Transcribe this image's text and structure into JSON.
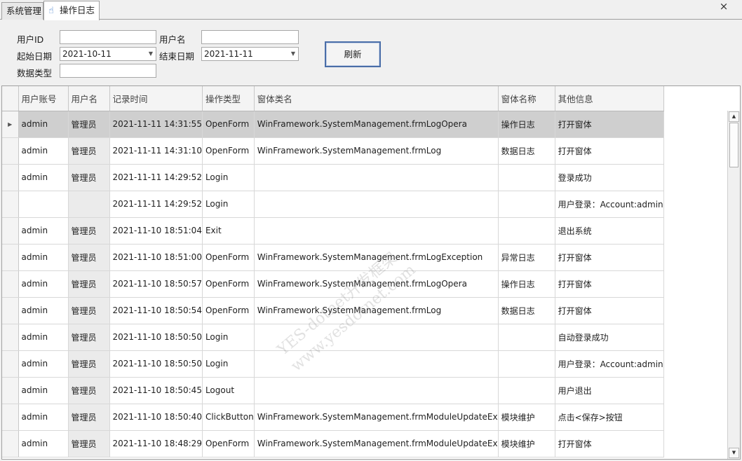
{
  "tabs": [
    {
      "label": "系统管理",
      "active": false
    },
    {
      "label": "操作日志",
      "active": true,
      "icon": "hand-pointer-icon"
    }
  ],
  "close_glyph": "×",
  "filters": {
    "user_id_label": "用户ID",
    "user_id_value": "",
    "user_name_label": "用户名",
    "user_name_value": "",
    "start_date_label": "起始日期",
    "start_date_value": "2021-10-11",
    "end_date_label": "结束日期",
    "end_date_value": "2021-11-11",
    "data_type_label": "数据类型",
    "data_type_value": "",
    "refresh_label": "刷新"
  },
  "grid": {
    "columns": [
      "用户账号",
      "用户名",
      "记录时间",
      "操作类型",
      "窗体类名",
      "窗体名称",
      "其他信息"
    ],
    "rows": [
      [
        "admin",
        "管理员",
        "2021-11-11 14:31:55",
        "OpenForm",
        "WinFramework.SystemManagement.frmLogOpera",
        "操作日志",
        "打开窗体"
      ],
      [
        "admin",
        "管理员",
        "2021-11-11 14:31:10",
        "OpenForm",
        "WinFramework.SystemManagement.frmLog",
        "数据日志",
        "打开窗体"
      ],
      [
        "admin",
        "管理员",
        "2021-11-11 14:29:52",
        "Login",
        "",
        "",
        "登录成功"
      ],
      [
        "",
        "",
        "2021-11-11 14:29:52",
        "Login",
        "",
        "",
        "用户登录：Account:admin"
      ],
      [
        "admin",
        "管理员",
        "2021-11-10 18:51:04",
        "Exit",
        "",
        "",
        "退出系统"
      ],
      [
        "admin",
        "管理员",
        "2021-11-10 18:51:00",
        "OpenForm",
        "WinFramework.SystemManagement.frmLogException",
        "异常日志",
        "打开窗体"
      ],
      [
        "admin",
        "管理员",
        "2021-11-10 18:50:57",
        "OpenForm",
        "WinFramework.SystemManagement.frmLogOpera",
        "操作日志",
        "打开窗体"
      ],
      [
        "admin",
        "管理员",
        "2021-11-10 18:50:54",
        "OpenForm",
        "WinFramework.SystemManagement.frmLog",
        "数据日志",
        "打开窗体"
      ],
      [
        "admin",
        "管理员",
        "2021-11-10 18:50:50",
        "Login",
        "",
        "",
        "自动登录成功"
      ],
      [
        "admin",
        "管理员",
        "2021-11-10 18:50:50",
        "Login",
        "",
        "",
        "用户登录：Account:admin"
      ],
      [
        "admin",
        "管理员",
        "2021-11-10 18:50:45",
        "Logout",
        "",
        "",
        "用户退出"
      ],
      [
        "admin",
        "管理员",
        "2021-11-10 18:50:40",
        "ClickButton",
        "WinFramework.SystemManagement.frmModuleUpdateEx",
        "模块维护",
        "点击<保存>按钮"
      ],
      [
        "admin",
        "管理员",
        "2021-11-10 18:48:29",
        "OpenForm",
        "WinFramework.SystemManagement.frmModuleUpdateEx",
        "模块维护",
        "打开窗体"
      ]
    ],
    "selected_row": 0
  },
  "watermark": {
    "line1": "YES-dotnet开发框架",
    "line2": "www.yesdotnet.com"
  }
}
